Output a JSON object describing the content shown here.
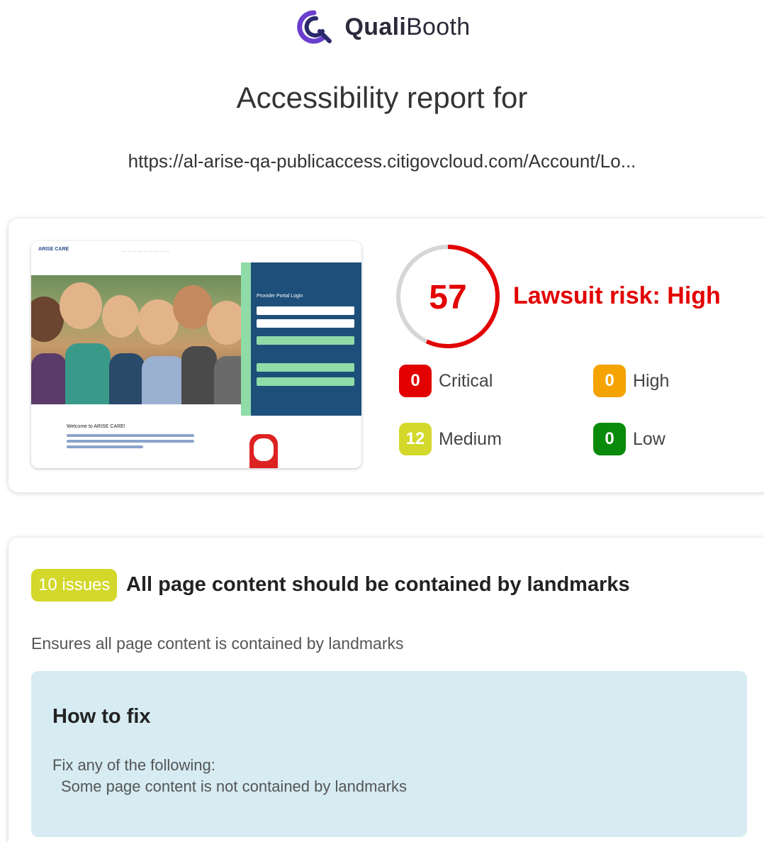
{
  "brand": {
    "name_bold": "Quali",
    "name_light": "Booth"
  },
  "report": {
    "title": "Accessibility report for",
    "url": "https://al-arise-qa-publicaccess.citigovcloud.com/Account/Lo..."
  },
  "score": {
    "value": "57",
    "risk_label": "Lawsuit risk: High",
    "fraction": 0.57
  },
  "severity": {
    "critical": {
      "count": "0",
      "label": "Critical"
    },
    "high": {
      "count": "0",
      "label": "High"
    },
    "medium": {
      "count": "12",
      "label": "Medium"
    },
    "low": {
      "count": "0",
      "label": "Low"
    }
  },
  "thumbnail": {
    "logo_text": "ARISE CARE",
    "login_title": "Provider Portal Login",
    "welcome": "Welcome to ARISE CARE!"
  },
  "issue": {
    "count_label": "10 issues",
    "title": "All page content should be contained by landmarks",
    "description": "Ensures all page content is contained by landmarks",
    "fix": {
      "title": "How to fix",
      "line1": "Fix any of the following:",
      "line2": "Some page content is not contained by landmarks"
    }
  },
  "colors": {
    "critical": "#e30000",
    "high": "#f5a300",
    "medium": "#d3d82a",
    "low": "#0a8a0a",
    "brand": "#6a3fcf",
    "fix_bg": "#d6ebf2"
  }
}
